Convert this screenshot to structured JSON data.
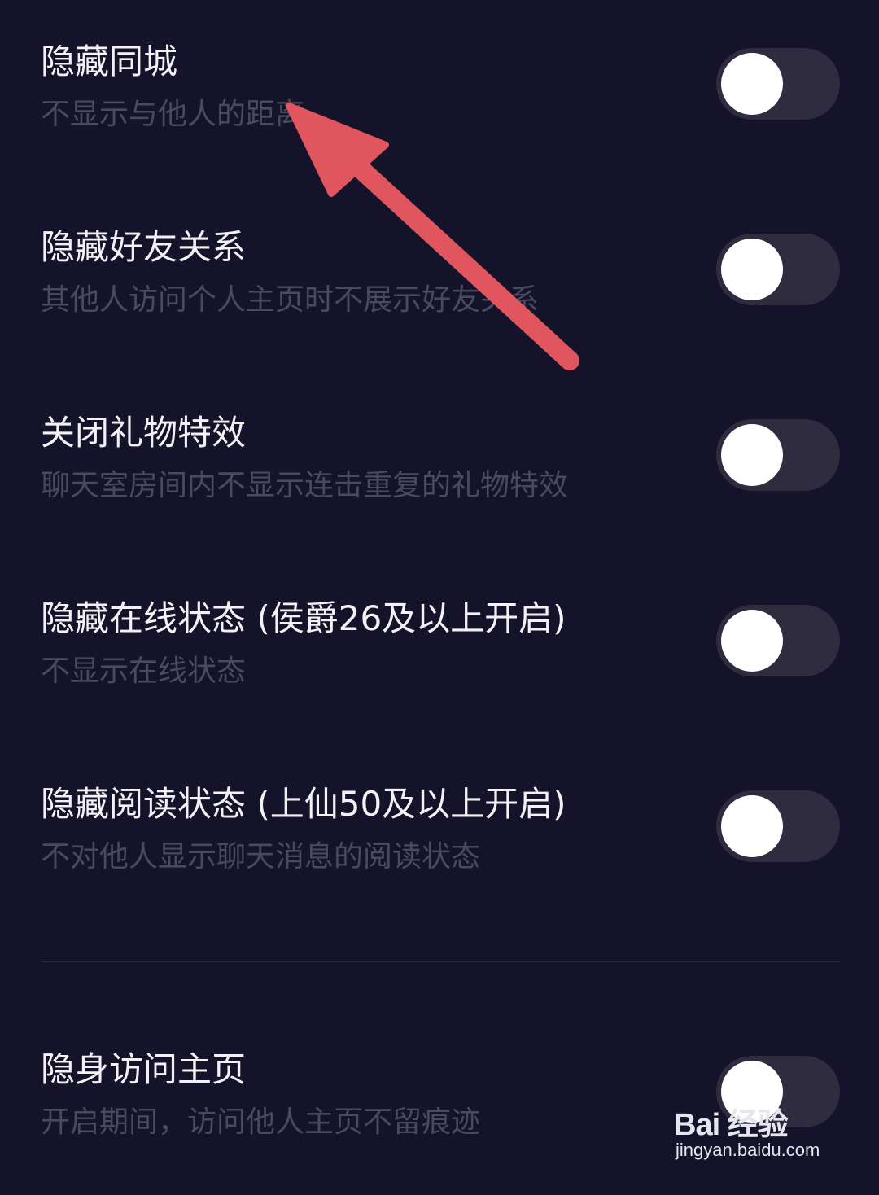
{
  "settings": [
    {
      "title": "隐藏同城",
      "subtitle": "不显示与他人的距离",
      "enabled": false
    },
    {
      "title": "隐藏好友关系",
      "subtitle": "其他人访问个人主页时不展示好友关系",
      "enabled": false
    },
    {
      "title": "关闭礼物特效",
      "subtitle": "聊天室房间内不显示连击重复的礼物特效",
      "enabled": false
    },
    {
      "title": "隐藏在线状态 (侯爵26及以上开启)",
      "subtitle": "不显示在线状态",
      "enabled": false
    },
    {
      "title": "隐藏阅读状态 (上仙50及以上开启)",
      "subtitle": "不对他人显示聊天消息的阅读状态",
      "enabled": false
    },
    {
      "title": "隐身访问主页",
      "subtitle": "开启期间，访问他人主页不留痕迹",
      "enabled": false
    }
  ],
  "annotation": {
    "color": "#e0555e",
    "icon": "arrow-icon"
  },
  "watermark": {
    "logo": "Bai 经验",
    "url": "jingyan.baidu.com"
  }
}
